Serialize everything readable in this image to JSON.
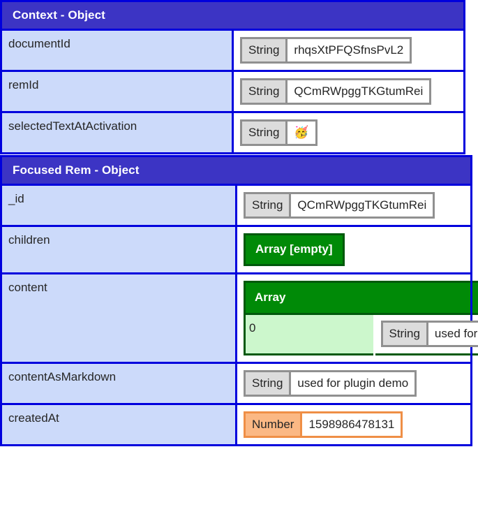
{
  "sections": [
    {
      "id": "context",
      "title": "Context - Object",
      "rows": [
        {
          "key": "documentId",
          "value_kind": "scalar",
          "type_label": "String",
          "type_kind": "string",
          "value": "rhqsXtPFQSfnsPvL2"
        },
        {
          "key": "remId",
          "value_kind": "scalar",
          "type_label": "String",
          "type_kind": "string",
          "value": "QCmRWpggTKGtumRei"
        },
        {
          "key": "selectedTextAtActivation",
          "value_kind": "scalar",
          "type_label": "String",
          "type_kind": "string",
          "value": "🥳"
        }
      ]
    },
    {
      "id": "focused-rem",
      "title": "Focused Rem - Object",
      "rows": [
        {
          "key": "_id",
          "value_kind": "scalar",
          "type_label": "String",
          "type_kind": "string",
          "value": "QCmRWpggTKGtumRei"
        },
        {
          "key": "children",
          "value_kind": "array_empty",
          "type_label": "Array [empty]"
        },
        {
          "key": "content",
          "value_kind": "array",
          "type_label": "Array",
          "items": [
            {
              "index": "0",
              "type_label": "String",
              "type_kind": "string",
              "value": "used for plugin demo"
            }
          ]
        },
        {
          "key": "contentAsMarkdown",
          "value_kind": "scalar",
          "type_label": "String",
          "type_kind": "string",
          "value": "used for plugin demo"
        },
        {
          "key": "createdAt",
          "value_kind": "scalar",
          "type_label": "Number",
          "type_kind": "number",
          "value": "1598986478131"
        }
      ]
    }
  ],
  "colors": {
    "header_bg": "#3c34c4",
    "table_border": "#0000dd",
    "key_bg": "#ccdafa",
    "array_green": "#008a07",
    "array_green_dark": "#00590c",
    "array_index_bg": "#ccf7cc",
    "string_border": "#909090",
    "string_label_bg": "#dcdcdc",
    "number_border": "#ef8f46",
    "number_label_bg": "#fbb884",
    "page_bg": "#ffffff"
  }
}
